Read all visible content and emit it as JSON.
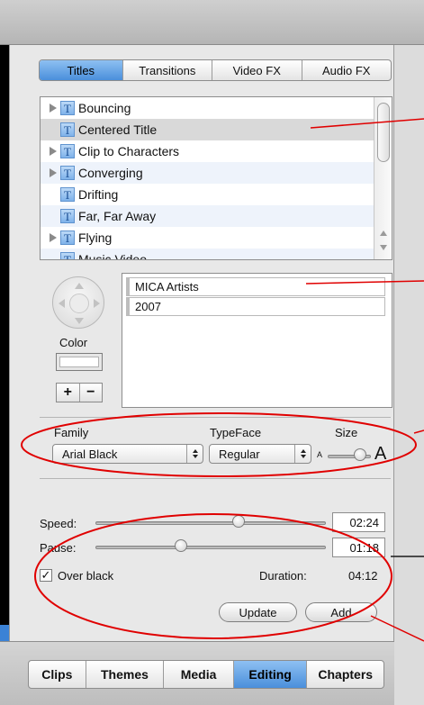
{
  "top_tabs": [
    {
      "label": "Titles",
      "selected": true
    },
    {
      "label": "Transitions",
      "selected": false
    },
    {
      "label": "Video FX",
      "selected": false
    },
    {
      "label": "Audio FX",
      "selected": false
    }
  ],
  "title_list": [
    {
      "label": "Bouncing",
      "expandable": true
    },
    {
      "label": "Centered Title",
      "expandable": false,
      "selected": true
    },
    {
      "label": "Clip to Characters",
      "expandable": true
    },
    {
      "label": "Converging",
      "expandable": true
    },
    {
      "label": "Drifting",
      "expandable": false
    },
    {
      "label": "Far, Far Away",
      "expandable": false
    },
    {
      "label": "Flying",
      "expandable": true
    },
    {
      "label": "Music Video",
      "expandable": false
    }
  ],
  "title_icon_glyph": "T",
  "color_label": "Color",
  "plus_label": "+",
  "minus_label": "−",
  "title_lines": [
    "MICA Artists",
    "2007"
  ],
  "font": {
    "family_label": "Family",
    "family_value": "Arial Black",
    "typeface_label": "TypeFace",
    "typeface_value": "Regular",
    "size_label": "Size",
    "size_small": "A",
    "size_large": "A",
    "size_level": 0.75
  },
  "timing": {
    "speed_label": "Speed:",
    "speed_value": "02:24",
    "speed_level": 0.62,
    "pause_label": "Pause:",
    "pause_value": "01:18",
    "pause_level": 0.37,
    "over_black_label": "Over black",
    "over_black_checked": true,
    "check_glyph": "✓",
    "duration_label": "Duration:",
    "duration_value": "04:12"
  },
  "buttons": {
    "update": "Update",
    "add": "Add"
  },
  "bottom_tabs": [
    {
      "label": "Clips",
      "selected": false
    },
    {
      "label": "Themes",
      "selected": false
    },
    {
      "label": "Media",
      "selected": false
    },
    {
      "label": "Editing",
      "selected": true
    },
    {
      "label": "Chapters",
      "selected": false
    }
  ],
  "colors": {
    "accent": "#4a8fdb",
    "annotation": "#e00000"
  },
  "icons": [
    "disclosure-triangle-icon",
    "title-t-icon",
    "direction-pad-icon",
    "checkbox-check-icon"
  ]
}
